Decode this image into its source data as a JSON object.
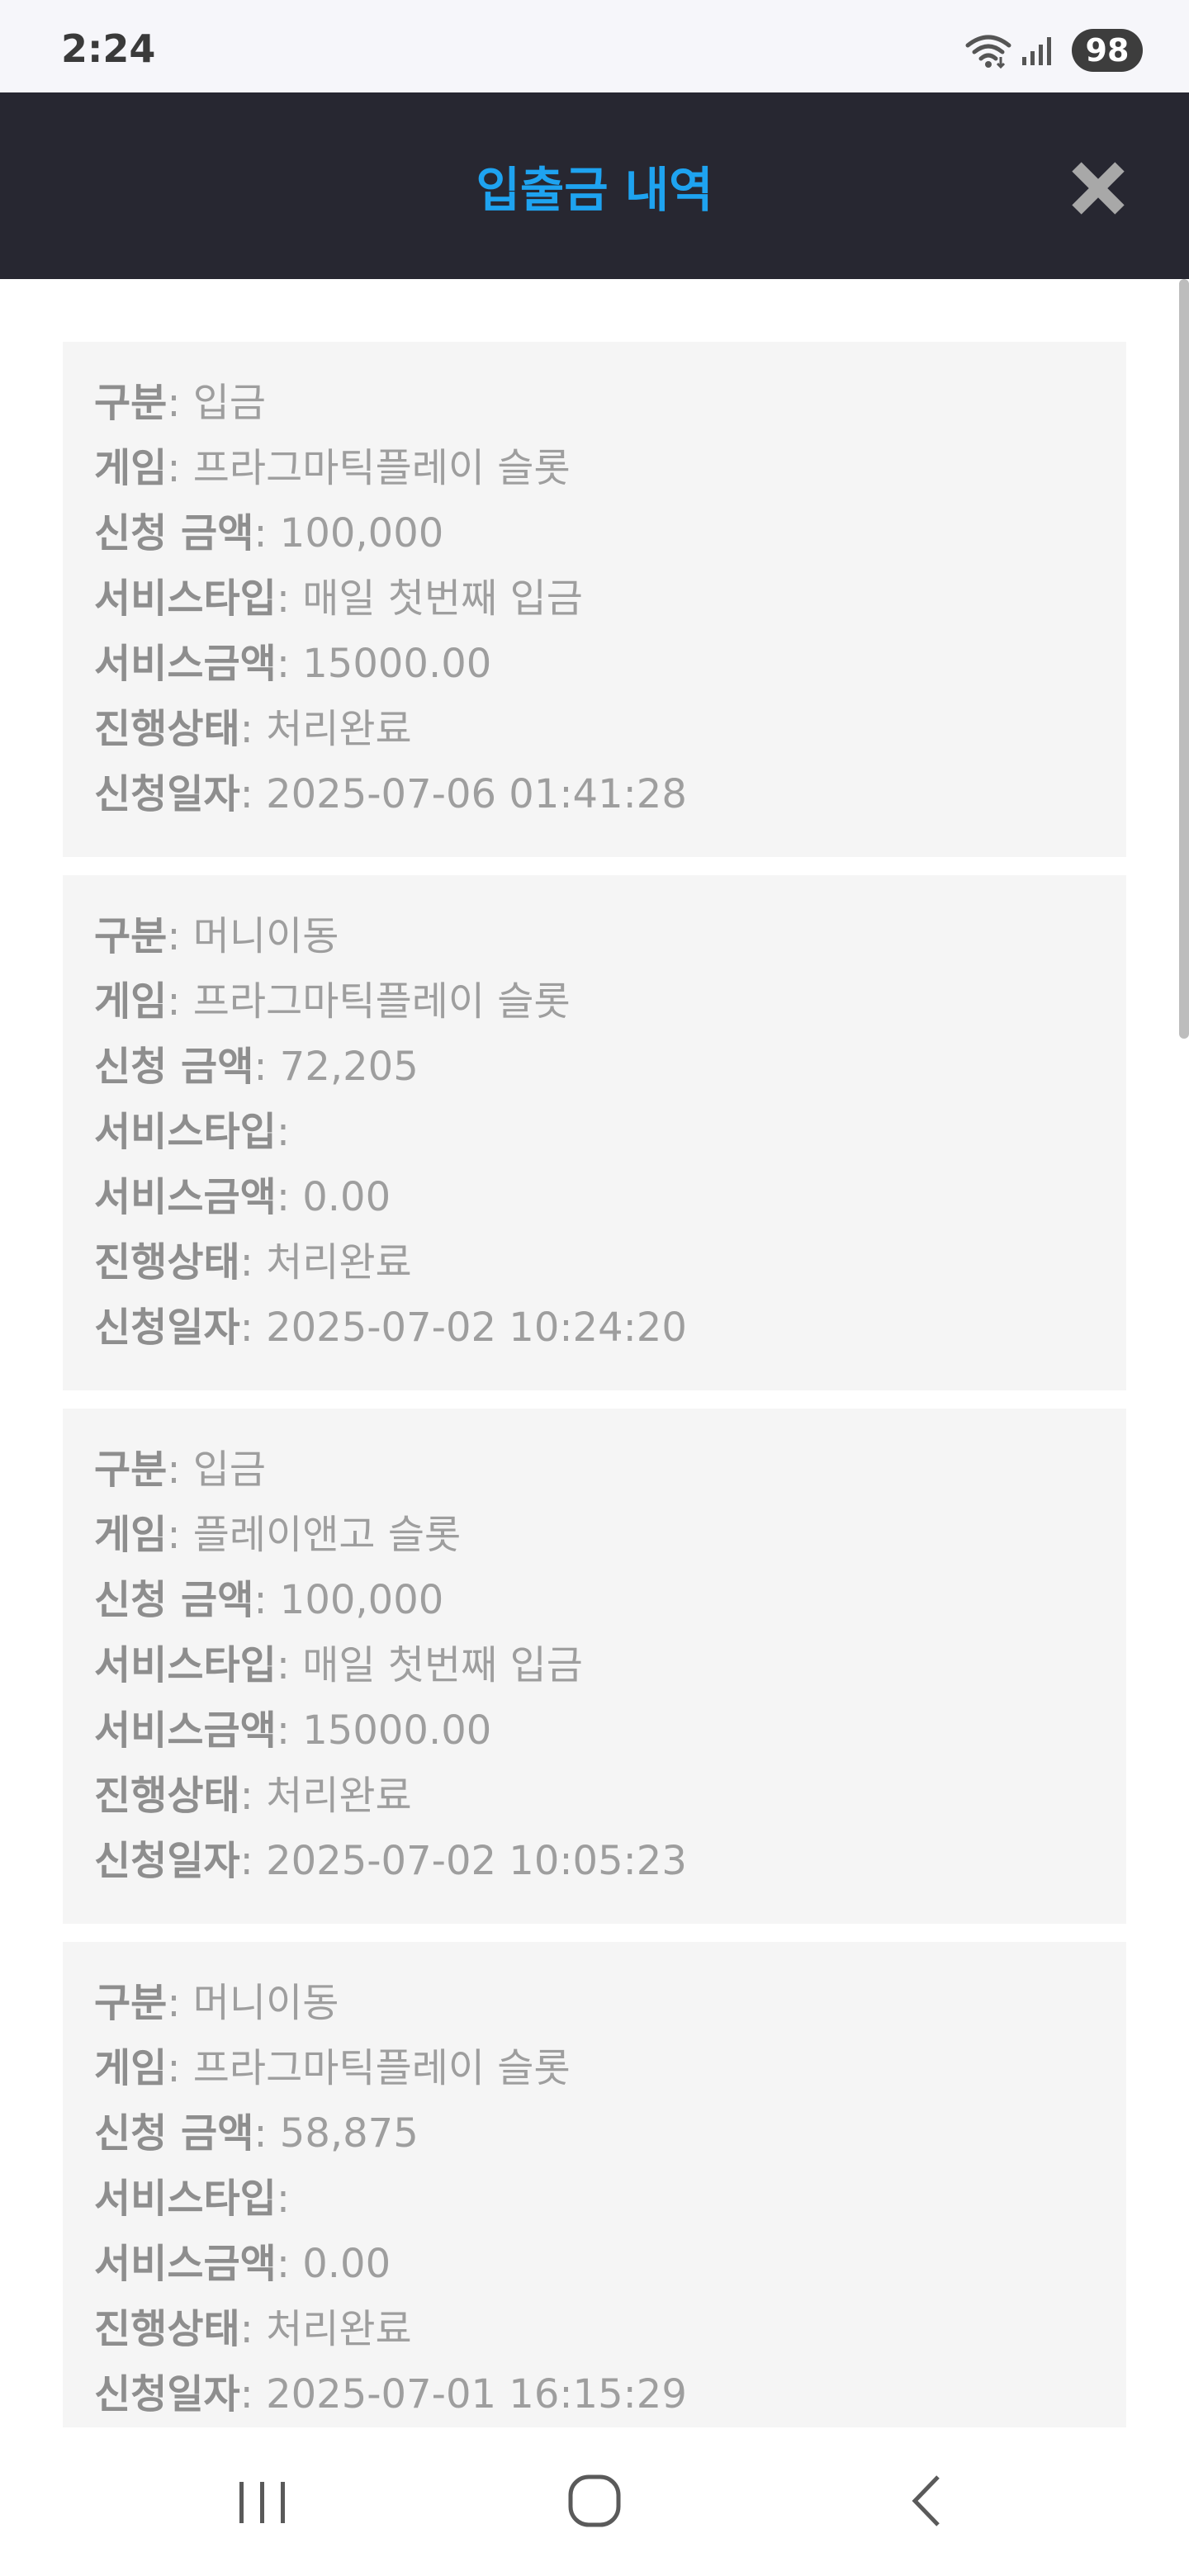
{
  "status_bar": {
    "time": "2:24",
    "battery": "98"
  },
  "header": {
    "title": "입출금 내역"
  },
  "labels": {
    "type": "구분",
    "game": "게임",
    "amount": "신청 금액",
    "service_type": "서비스타입",
    "service_amount": "서비스금액",
    "status": "진행상태",
    "date": "신청일자"
  },
  "records": [
    {
      "type": "입금",
      "game": "프라그마틱플레이 슬롯",
      "amount": "100,000",
      "service_type": "매일 첫번째 입금",
      "service_amount": "15000.00",
      "status": "처리완료",
      "date": "2025-07-06 01:41:28"
    },
    {
      "type": "머니이동",
      "game": "프라그마틱플레이 슬롯",
      "amount": "72,205",
      "service_type": "",
      "service_amount": "0.00",
      "status": "처리완료",
      "date": "2025-07-02 10:24:20"
    },
    {
      "type": "입금",
      "game": "플레이앤고 슬롯",
      "amount": "100,000",
      "service_type": "매일 첫번째 입금",
      "service_amount": "15000.00",
      "status": "처리완료",
      "date": "2025-07-02 10:05:23"
    },
    {
      "type": "머니이동",
      "game": "프라그마틱플레이 슬롯",
      "amount": "58,875",
      "service_type": "",
      "service_amount": "0.00",
      "status": "처리완료",
      "date": "2025-07-01 16:15:29"
    }
  ],
  "icons": {
    "close": "close-icon",
    "wifi": "wifi-icon",
    "signal": "signal-icon",
    "nav_recent": "recent-apps-icon",
    "nav_home": "home-icon",
    "nav_back": "back-icon"
  },
  "colors": {
    "header_bg": "#272731",
    "title": "#1ea3f0",
    "card_bg": "#f5f5f5",
    "text": "#9e9e9e",
    "close_icon": "#a8a8a8"
  }
}
